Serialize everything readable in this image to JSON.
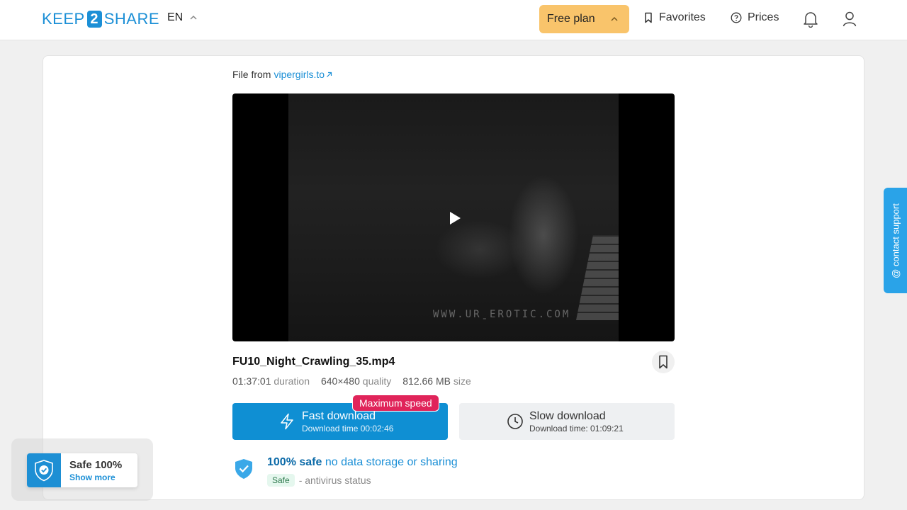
{
  "header": {
    "logo_left": "KEEP",
    "logo_num": "2",
    "logo_right": "SHARE",
    "language": "EN",
    "plan_label": "Free plan",
    "favorites_label": "Favorites",
    "prices_label": "Prices"
  },
  "file": {
    "source_prefix": "File from",
    "source_link": "vipergirls.to",
    "name": "FU10_Night_Crawling_35.mp4",
    "duration": "01:37:01",
    "duration_label": "duration",
    "quality": "640×480",
    "quality_label": "quality",
    "size": "812.66 MB",
    "size_label": "size",
    "video_watermark": "WWW.URˍEROTIC.COM"
  },
  "download": {
    "fast_label": "Fast download",
    "fast_time": "Download time 00:02:46",
    "fast_badge": "Maximum speed",
    "slow_label": "Slow download",
    "slow_time": "Download time: 01:09:21"
  },
  "safety": {
    "headline_bold": "100% safe",
    "headline_rest": "no data storage or sharing",
    "antivirus_badge": "Safe",
    "antivirus_label": "- antivirus status"
  },
  "support": {
    "label": "@ contact support"
  },
  "safe_widget": {
    "title": "Safe 100%",
    "link": "Show more"
  },
  "colors": {
    "brand": "#1b8fd6",
    "plan": "#f9c46b",
    "fast_button": "#0f8fd3",
    "badge": "#e0245a",
    "support_tab": "#2aa3e8"
  }
}
